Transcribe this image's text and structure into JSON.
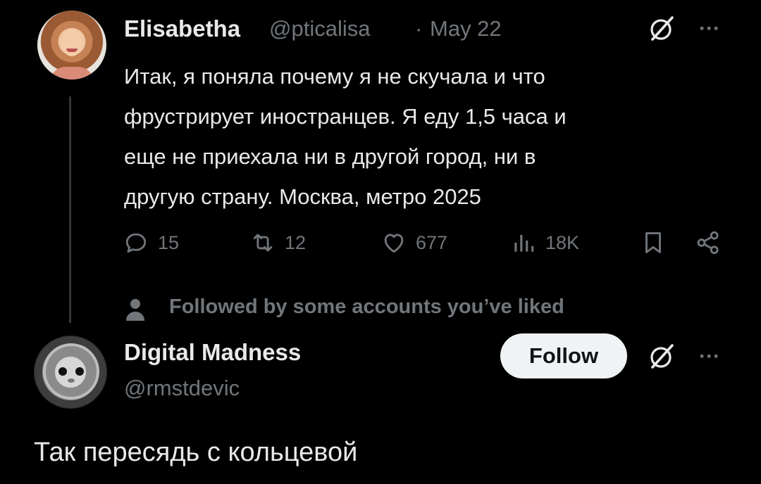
{
  "tweet": {
    "author_name": "Elisabetha",
    "author_handle": "@pticalisa",
    "separator": "·",
    "date": "May 22",
    "text": "Итак, я поняла почему я не скучала и что\nфрустрирует иностранцев. Я еду 1,5 часа и\nеще не приехала ни в другой город, ни в\nдругую страну. Москва, метро 2025",
    "more_label": "···",
    "metrics": {
      "replies": "15",
      "reposts": "12",
      "likes": "677",
      "views": "18K"
    },
    "icons": {
      "reply": "reply-icon",
      "repost": "repost-icon",
      "like": "heart-icon",
      "views": "views-chart-icon",
      "bookmark": "bookmark-icon",
      "share": "share-icon",
      "grok": "grok-icon"
    }
  },
  "social_context": {
    "icon": "person-icon",
    "text": "Followed by some accounts you’ve liked"
  },
  "reply": {
    "author_name": "Digital Madness",
    "author_handle": "@rmstdevic",
    "follow_label": "Follow",
    "more_label": "···",
    "text": "Так пересядь с кольцевой"
  },
  "colors": {
    "background": "#000000",
    "text_primary": "#e7e9ea",
    "text_secondary": "#71767b",
    "thread_line": "#333639",
    "follow_button_bg": "#eff3f4",
    "follow_button_text": "#0f1419"
  }
}
